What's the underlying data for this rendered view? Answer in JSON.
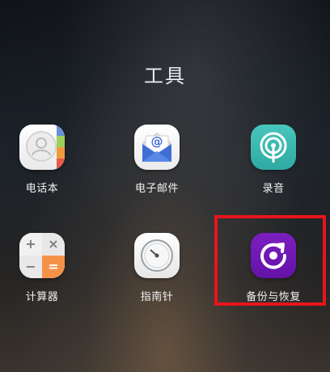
{
  "folder": {
    "title": "工具"
  },
  "apps": [
    {
      "label": "电话本",
      "icon": "contacts-icon"
    },
    {
      "label": "电子邮件",
      "icon": "email-icon"
    },
    {
      "label": "录音",
      "icon": "recorder-icon"
    },
    {
      "label": "计算器",
      "icon": "calculator-icon"
    },
    {
      "label": "指南针",
      "icon": "compass-icon"
    },
    {
      "label": "备份与恢复",
      "icon": "backup-restore-icon"
    }
  ],
  "calculator": {
    "plus": "+",
    "times": "×",
    "minus": "−",
    "equals": "="
  },
  "email": {
    "at": "@"
  },
  "colors": {
    "highlight": "#e8141c",
    "backup_purple": "#7b1fc0",
    "recorder_teal": "#3dbab1",
    "calc_orange": "#f5924a",
    "email_blue": "#3f6fd6"
  }
}
